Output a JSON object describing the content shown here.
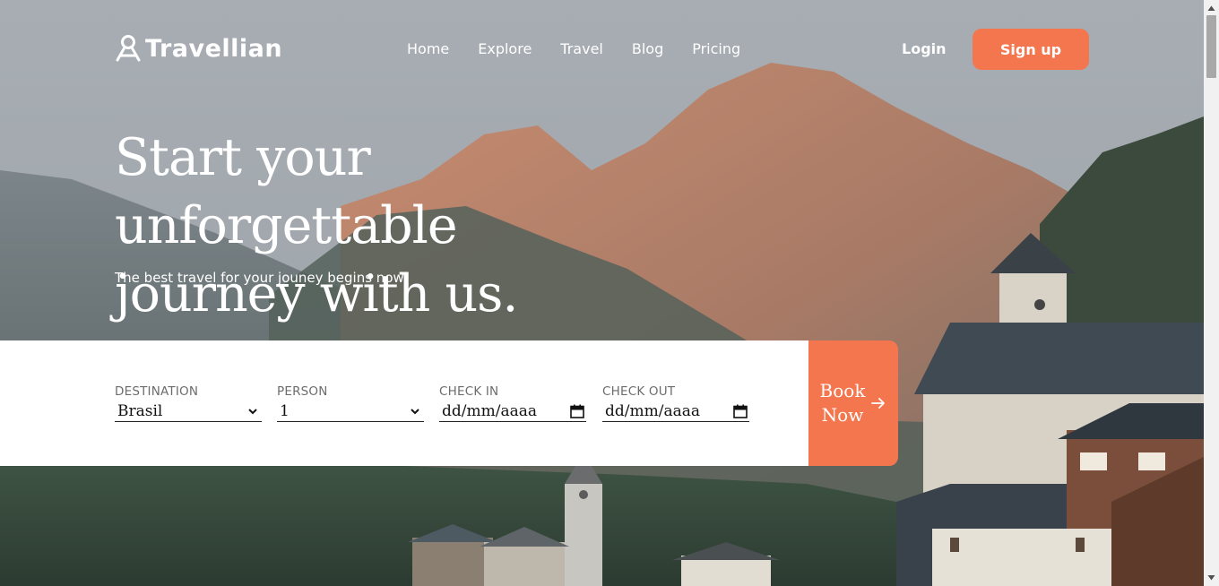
{
  "brand": {
    "name": "Travellian"
  },
  "nav": {
    "links": [
      "Home",
      "Explore",
      "Travel",
      "Blog",
      "Pricing"
    ],
    "login_label": "Login",
    "signup_label": "Sign up"
  },
  "hero": {
    "headline_line1": "Start your unforgettable",
    "headline_line2": "journey with us.",
    "subline": "The best travel for your jouney begins now"
  },
  "booking": {
    "destination": {
      "label": "DESTINATION",
      "value": "Brasil"
    },
    "person": {
      "label": "PERSON",
      "value": "1"
    },
    "check_in": {
      "label": "CHECK IN",
      "value": "dd/mm/aaaa"
    },
    "check_out": {
      "label": "CHECK OUT",
      "value": "dd/mm/aaaa"
    },
    "book_line1": "Book",
    "book_line2": "Now"
  },
  "colors": {
    "accent": "#f4764f",
    "form_bg": "#ffffff",
    "text_light": "#ffffff"
  },
  "icons": [
    "logo-icon",
    "chevron-down-icon",
    "calendar-icon",
    "arrow-right-icon",
    "scroll-up-icon",
    "scroll-down-icon"
  ]
}
